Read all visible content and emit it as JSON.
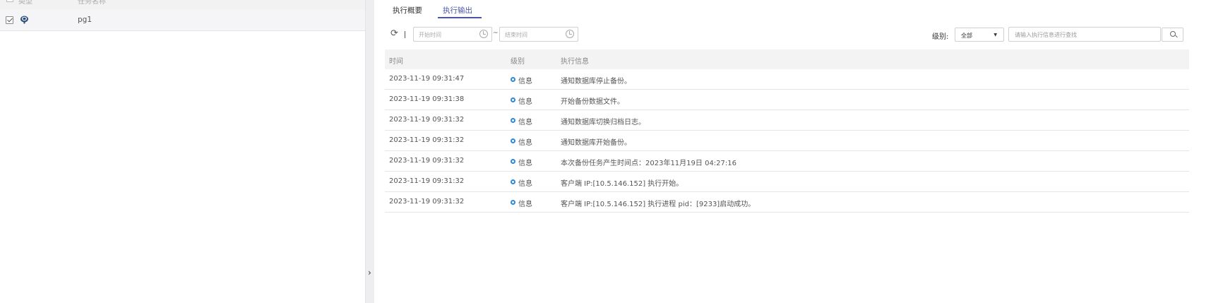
{
  "left": {
    "header": {
      "type_label": "类型",
      "name_label": "任务名称"
    },
    "row": {
      "name": "pg1"
    }
  },
  "tabs": [
    {
      "label": "执行概要"
    },
    {
      "label": "执行输出",
      "active": true
    }
  ],
  "toolbar": {
    "start_placeholder": "开始时间",
    "end_placeholder": "结束时间",
    "range_separator": "~",
    "level_label": "级别:",
    "level_value": "全部",
    "search_placeholder": "请输入执行信息进行查找"
  },
  "table": {
    "columns": [
      "时间",
      "级别",
      "执行信息"
    ],
    "rows": [
      {
        "time": "2023-11-19 09:31:47",
        "level": "信息",
        "message": "通知数据库停止备份。"
      },
      {
        "time": "2023-11-19 09:31:38",
        "level": "信息",
        "message": "开始备份数据文件。"
      },
      {
        "time": "2023-11-19 09:31:32",
        "level": "信息",
        "message": "通知数据库切换归档日志。"
      },
      {
        "time": "2023-11-19 09:31:32",
        "level": "信息",
        "message": "通知数据库开始备份。"
      },
      {
        "time": "2023-11-19 09:31:32",
        "level": "信息",
        "message": "本次备份任务产生时间点：2023年11月19日 04:27:16"
      },
      {
        "time": "2023-11-19 09:31:32",
        "level": "信息",
        "message": "客户端 IP:[10.5.146.152] 执行开始。"
      },
      {
        "time": "2023-11-19 09:31:32",
        "level": "信息",
        "message": "客户端 IP:[10.5.146.152] 执行进程 pid：[9233]启动成功。"
      }
    ]
  },
  "colors": {
    "accent": "#4a55a8",
    "info_dot": "#2f87d6"
  }
}
